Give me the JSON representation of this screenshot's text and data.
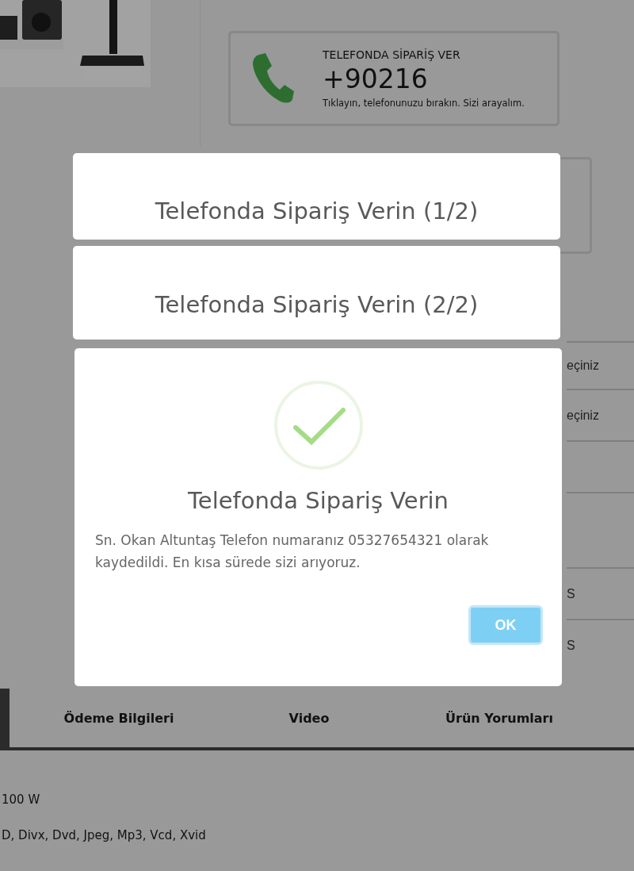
{
  "order_card": {
    "heading": "TELEFONDA SİPARİŞ VER",
    "phone": "+90216",
    "note": "Tıklayın, telefonunuzu bırakın. Sizi arayalım."
  },
  "side_rows": [
    "eçiniz",
    "eçiniz",
    "",
    "",
    "S",
    "S"
  ],
  "tabs": [
    {
      "label": "Ödeme Bilgileri",
      "selected": false
    },
    {
      "label": "Video",
      "selected": false
    },
    {
      "label": "Ürün Yorumları",
      "selected": false
    }
  ],
  "specs": [
    "100 W",
    "D, Divx, Dvd, Jpeg, Mp3, Vcd, Xvid"
  ],
  "dialogs": [
    {
      "title": "Telefonda Sipariş Verin (1/2)"
    },
    {
      "title": "Telefonda Sipariş Verin (2/2)"
    },
    {
      "title": "Telefonda Sipariş Verin",
      "message": "Sn. Okan Altuntaş Telefon numaranız 05327654321 olarak kaydedildi. En kısa sürede sizi arıyoruz.",
      "button": "OK"
    }
  ]
}
